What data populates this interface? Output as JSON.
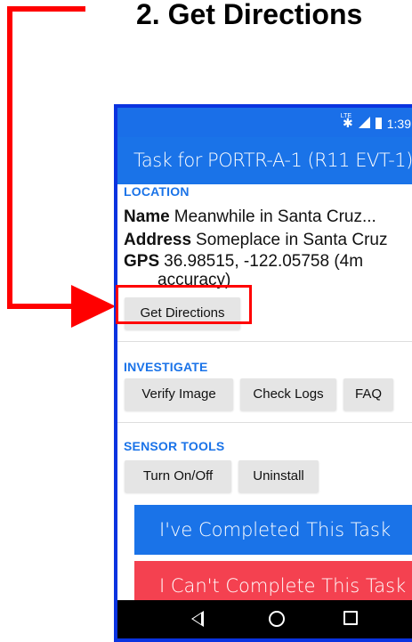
{
  "caption": "2. Get Directions",
  "status_bar": {
    "time": "1:39",
    "lte_label": "LTE",
    "bluetooth_icon": "bluetooth-icon",
    "signal_icon": "cell-signal-icon",
    "battery_icon": "battery-icon"
  },
  "app_bar": {
    "title": "Task for PORTR-A-1 (R11 EVT-1)"
  },
  "location": {
    "heading": "LOCATION",
    "name_label": "Name",
    "name_value": "Meanwhile in Santa Cruz...",
    "address_label": "Address",
    "address_value": "Someplace in Santa Cruz",
    "gps_label": "GPS",
    "gps_value": "36.98515, -122.05758 (4m",
    "gps_value_cont": "accuracy)",
    "directions_button": "Get Directions"
  },
  "investigate": {
    "heading": "INVESTIGATE",
    "buttons": [
      "Verify Image",
      "Check Logs",
      "FAQ"
    ]
  },
  "sensor_tools": {
    "heading": "SENSOR TOOLS",
    "buttons": [
      "Turn On/Off",
      "Uninstall"
    ]
  },
  "actions": {
    "complete": "I've Completed This Task",
    "cannot_complete": "I Can't Complete This Task"
  },
  "nav_bar": {
    "back_icon": "back-triangle-icon",
    "home_icon": "home-circle-icon",
    "recents_icon": "recents-square-icon"
  },
  "colors": {
    "annotation_red": "#ff0000",
    "app_blue": "#1a73e8",
    "phone_border": "#0a33e0",
    "complete_button": "#1a73e8",
    "cannot_complete_button": "#f44150",
    "gray_button": "#e5e5e5"
  }
}
